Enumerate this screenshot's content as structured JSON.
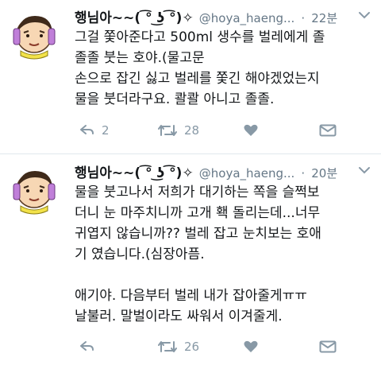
{
  "tweets": [
    {
      "name": "행님아~~( ͡° ͜ʖ ͡°)✧",
      "handle": "@hoya_haeng...",
      "dot": "·",
      "time": "22분",
      "lines": [
        "그걸 쫓아준다고 500ml 생수를 벌레에게 졸",
        "졸졸 붓는 호야.(물고문",
        "손으로 잡긴 싫고 벌레를 쫓긴 해야겠었는지",
        "물을 붓더라구요. 콸콸 아니고 졸졸."
      ],
      "replies": "2",
      "retweets": "28",
      "likes": ""
    },
    {
      "name": "행님아~~( ͡° ͜ʖ ͡°)✧",
      "handle": "@hoya_haeng...",
      "dot": "·",
      "time": "20분",
      "lines": [
        "물을 붓고나서 저희가 대기하는 쪽을 슬쩍보",
        "더니 눈 마주치니까 고개 홱 돌리는데...너무",
        "귀엽지 않습니까?? 벌레 잡고 눈치보는 호애",
        "기 였습니다.(심장아픔.",
        "",
        "애기야. 다음부터 벌레 내가 잡아줄게ㅠㅠ",
        "날불러. 말벌이라도 싸워서 이겨줄게."
      ],
      "replies": "",
      "retweets": "26",
      "likes": ""
    }
  ],
  "icons": {
    "reply": "reply-icon",
    "retweet": "retweet-icon",
    "like": "heart-icon",
    "dm": "envelope-icon",
    "more": "chevron-down-icon",
    "avatar": "cartoon-avatar"
  },
  "colors": {
    "icon_gray": "#8899a6",
    "text": "#14171a",
    "meta": "#657786"
  }
}
